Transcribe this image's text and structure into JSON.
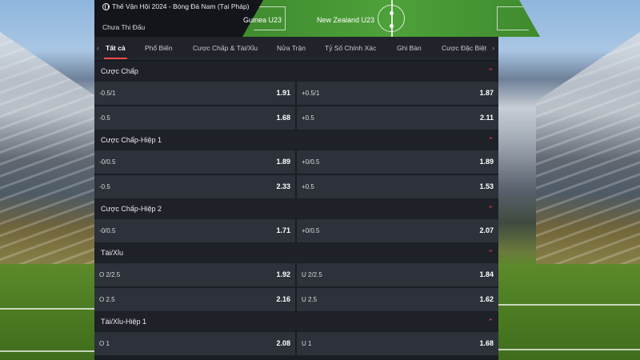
{
  "header": {
    "title": "Thế Vận Hội 2024 - Bóng Đá Nam (Tại Pháp)",
    "status": "Chưa Thi Đấu",
    "home_team": "Guinea U23",
    "away_team": "New Zealand U23"
  },
  "tabs": [
    {
      "label": "Tất cả",
      "active": true
    },
    {
      "label": "Phổ Biến"
    },
    {
      "label": "Cược Chấp & Tài/Xỉu"
    },
    {
      "label": "Nửa Trận"
    },
    {
      "label": "Tỷ Số Chính Xác"
    },
    {
      "label": "Ghi Bàn"
    },
    {
      "label": "Cược Đặc Biệt"
    }
  ],
  "sections": [
    {
      "title": "Cược Chấp",
      "rows": [
        {
          "left_label": "-0.5/1",
          "left_odd": "1.91",
          "right_label": "+0.5/1",
          "right_odd": "1.87"
        },
        {
          "left_label": "-0.5",
          "left_odd": "1.68",
          "right_label": "+0.5",
          "right_odd": "2.11"
        }
      ]
    },
    {
      "title": "Cược Chấp-Hiệp 1",
      "rows": [
        {
          "left_label": "-0/0.5",
          "left_odd": "1.89",
          "right_label": "+0/0.5",
          "right_odd": "1.89"
        },
        {
          "left_label": "-0.5",
          "left_odd": "2.33",
          "right_label": "+0.5",
          "right_odd": "1.53"
        }
      ]
    },
    {
      "title": "Cược Chấp-Hiệp 2",
      "rows": [
        {
          "left_label": "-0/0.5",
          "left_odd": "1.71",
          "right_label": "+0/0.5",
          "right_odd": "2.07"
        }
      ]
    },
    {
      "title": "Tài/Xỉu",
      "rows": [
        {
          "left_label": "O 2/2.5",
          "left_odd": "1.92",
          "right_label": "U 2/2.5",
          "right_odd": "1.84"
        },
        {
          "left_label": "O 2.5",
          "left_odd": "2.16",
          "right_label": "U 2.5",
          "right_odd": "1.62"
        }
      ]
    },
    {
      "title": "Tài/Xỉu-Hiệp 1",
      "rows": [
        {
          "left_label": "O 1",
          "left_odd": "2.08",
          "right_label": "U 1",
          "right_odd": "1.68"
        }
      ]
    }
  ],
  "colors": {
    "accent": "#ff4b4b",
    "panel": "#1a1d24",
    "cell": "#2d3139"
  }
}
